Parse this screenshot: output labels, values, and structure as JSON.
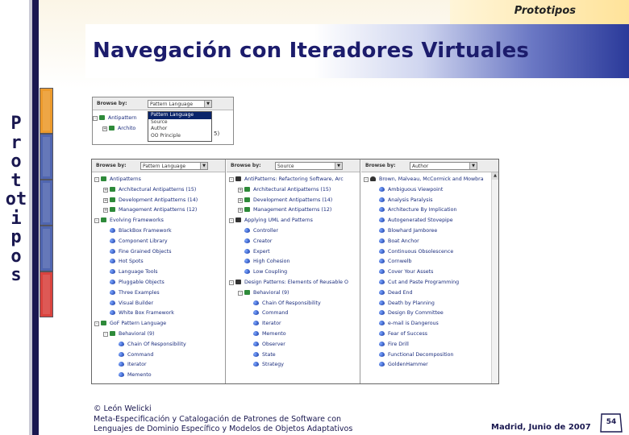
{
  "header": {
    "tag": "Prototipos",
    "title": "Navegación con Iteradores Virtuales"
  },
  "side_word": [
    "P",
    "r",
    "o",
    "t",
    "ot",
    "i",
    "p",
    "o",
    "s"
  ],
  "nav_tabs": [
    {
      "color": "#ec9a2c"
    },
    {
      "color": "#5066b0"
    },
    {
      "color": "#5066b0"
    },
    {
      "color": "#5066b0"
    },
    {
      "color": "#d9433e"
    }
  ],
  "small_shot": {
    "browse_label": "Browse by:",
    "select_value": "Pattern Language",
    "options": [
      "Pattern Language",
      "Source",
      "Author",
      "OO Principle"
    ],
    "tree": [
      "Antipattern",
      "Archito"
    ],
    "trailing": "5)"
  },
  "panels": [
    {
      "browse_label": "Browse by:",
      "select_value": "Pattern Language",
      "items": [
        {
          "label": "Antipatterns",
          "level": 0,
          "icon": "folder",
          "expand": "-"
        },
        {
          "label": "Architectural Antipatterns (15)",
          "level": 1,
          "icon": "folder",
          "expand": "+"
        },
        {
          "label": "Development Antipatterns (14)",
          "level": 1,
          "icon": "folder",
          "expand": "+"
        },
        {
          "label": "Management Antipatterns (12)",
          "level": 1,
          "icon": "folder",
          "expand": "+"
        },
        {
          "label": "Evolving Frameworks",
          "level": 0,
          "icon": "folder",
          "expand": "-"
        },
        {
          "label": "BlackBox Framework",
          "level": 1,
          "icon": "heart"
        },
        {
          "label": "Component Library",
          "level": 1,
          "icon": "heart"
        },
        {
          "label": "Fine Grained Objects",
          "level": 1,
          "icon": "heart"
        },
        {
          "label": "Hot Spots",
          "level": 1,
          "icon": "heart"
        },
        {
          "label": "Language Tools",
          "level": 1,
          "icon": "heart"
        },
        {
          "label": "Pluggable Objects",
          "level": 1,
          "icon": "heart"
        },
        {
          "label": "Three Examples",
          "level": 1,
          "icon": "heart"
        },
        {
          "label": "Visual Builder",
          "level": 1,
          "icon": "heart"
        },
        {
          "label": "White Box Framework",
          "level": 1,
          "icon": "heart"
        },
        {
          "label": "GoF Pattern Language",
          "level": 0,
          "icon": "folder",
          "expand": "-"
        },
        {
          "label": "Behavioral (9)",
          "level": 1,
          "icon": "folder",
          "expand": "-"
        },
        {
          "label": "Chain Of Responsibility",
          "level": 2,
          "icon": "heart"
        },
        {
          "label": "Command",
          "level": 2,
          "icon": "heart"
        },
        {
          "label": "Iterator",
          "level": 2,
          "icon": "heart"
        },
        {
          "label": "Memento",
          "level": 2,
          "icon": "heart"
        }
      ]
    },
    {
      "browse_label": "Browse by:",
      "select_value": "Source",
      "items": [
        {
          "label": "AntiPatterns: Refactoring Software, Arc",
          "level": 0,
          "icon": "book",
          "expand": "-"
        },
        {
          "label": "Architectural Antipatterns (15)",
          "level": 1,
          "icon": "folder",
          "expand": "+"
        },
        {
          "label": "Development Antipatterns (14)",
          "level": 1,
          "icon": "folder",
          "expand": "+"
        },
        {
          "label": "Management Antipatterns (12)",
          "level": 1,
          "icon": "folder",
          "expand": "+"
        },
        {
          "label": "Applying UML and Patterns",
          "level": 0,
          "icon": "book",
          "expand": "-"
        },
        {
          "label": "Controller",
          "level": 1,
          "icon": "heart"
        },
        {
          "label": "Creator",
          "level": 1,
          "icon": "heart"
        },
        {
          "label": "Expert",
          "level": 1,
          "icon": "heart"
        },
        {
          "label": "High Cohesion",
          "level": 1,
          "icon": "heart"
        },
        {
          "label": "Low Coupling",
          "level": 1,
          "icon": "heart"
        },
        {
          "label": "Design Patterns: Elements of Reusable O",
          "level": 0,
          "icon": "book",
          "expand": "-"
        },
        {
          "label": "Behavioral (9)",
          "level": 1,
          "icon": "folder",
          "expand": "-"
        },
        {
          "label": "Chain Of Responsibility",
          "level": 2,
          "icon": "heart"
        },
        {
          "label": "Command",
          "level": 2,
          "icon": "heart"
        },
        {
          "label": "Iterator",
          "level": 2,
          "icon": "heart"
        },
        {
          "label": "Memento",
          "level": 2,
          "icon": "heart"
        },
        {
          "label": "Observer",
          "level": 2,
          "icon": "heart"
        },
        {
          "label": "State",
          "level": 2,
          "icon": "heart"
        },
        {
          "label": "Strategy",
          "level": 2,
          "icon": "heart"
        }
      ]
    },
    {
      "browse_label": "Browse by:",
      "select_value": "Author",
      "items": [
        {
          "label": "Brown, Malveau, McCormick and Mowbra",
          "level": 0,
          "icon": "person",
          "expand": "-"
        },
        {
          "label": "Ambiguous Viewpoint",
          "level": 1,
          "icon": "heart"
        },
        {
          "label": "Analysis Paralysis",
          "level": 1,
          "icon": "heart"
        },
        {
          "label": "Architecture By Implication",
          "level": 1,
          "icon": "heart"
        },
        {
          "label": "Autogenerated Stovepipe",
          "level": 1,
          "icon": "heart"
        },
        {
          "label": "Blowhard Jamboree",
          "level": 1,
          "icon": "heart"
        },
        {
          "label": "Boat Anchor",
          "level": 1,
          "icon": "heart"
        },
        {
          "label": "Continuous Obsolescence",
          "level": 1,
          "icon": "heart"
        },
        {
          "label": "Cornwelb",
          "level": 1,
          "icon": "heart"
        },
        {
          "label": "Cover Your Assets",
          "level": 1,
          "icon": "heart"
        },
        {
          "label": "Cut and Paste Programming",
          "level": 1,
          "icon": "heart"
        },
        {
          "label": "Dead End",
          "level": 1,
          "icon": "heart"
        },
        {
          "label": "Death by Planning",
          "level": 1,
          "icon": "heart"
        },
        {
          "label": "Design By Committee",
          "level": 1,
          "icon": "heart"
        },
        {
          "label": "e-mail is Dangerous",
          "level": 1,
          "icon": "heart"
        },
        {
          "label": "Fear of Success",
          "level": 1,
          "icon": "heart"
        },
        {
          "label": "Fire Drill",
          "level": 1,
          "icon": "heart"
        },
        {
          "label": "Functional Decomposition",
          "level": 1,
          "icon": "heart"
        },
        {
          "label": "GoldenHammer",
          "level": 1,
          "icon": "heart"
        }
      ]
    }
  ],
  "footer": {
    "copyright": "© León Welicki",
    "line2": "Meta-Especificación y Catalogación de Patrones de Software con",
    "line3": "Lenguajes de Dominio Específico y Modelos de Objetos Adaptativos",
    "date": "Madrid, Junio de 2007",
    "page": "54"
  }
}
